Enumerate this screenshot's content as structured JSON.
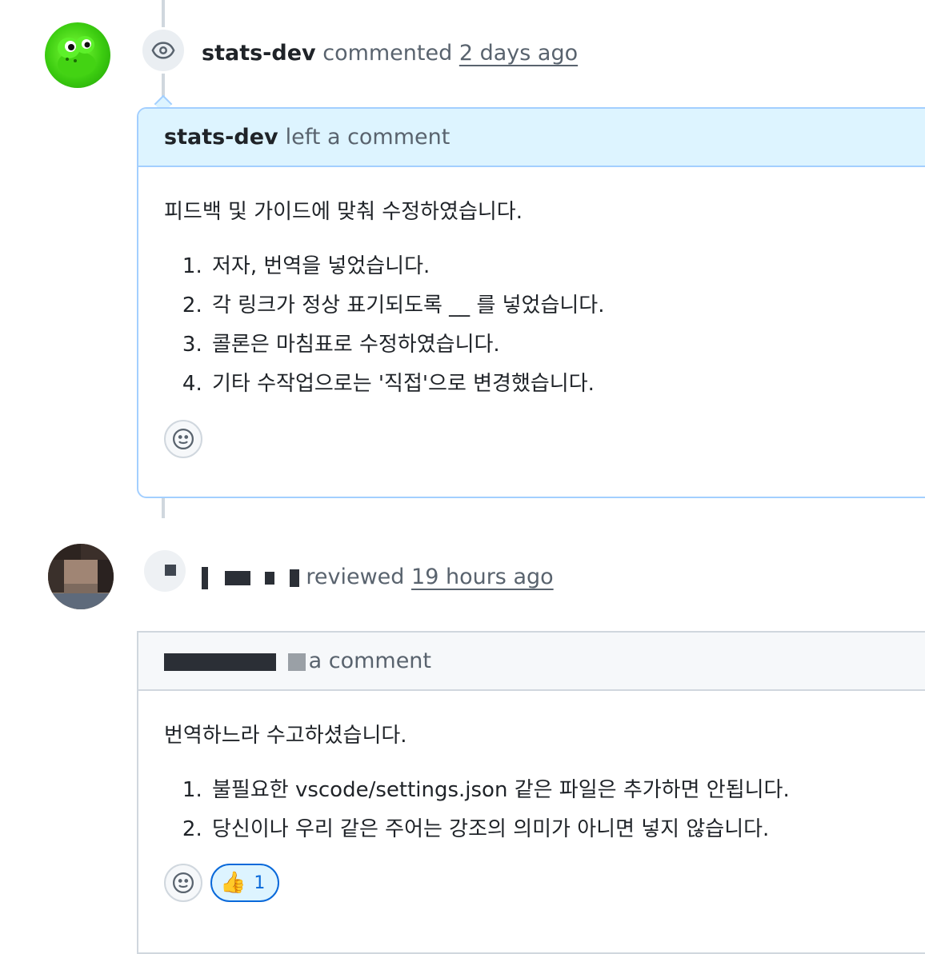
{
  "comments": [
    {
      "event_actor": "stats-dev",
      "event_verb": "commented",
      "event_time": "2 days ago",
      "event_icon": "eye-icon",
      "header_author": "stats-dev",
      "header_verb": "left a comment",
      "intro": "피드백 및 가이드에 맞춰 수정하였습니다.",
      "items": [
        "저자, 번역을 넣었습니다.",
        "각 링크가 정상 표기되도록 __ 를 넣었습니다.",
        "콜론은 마침표로 수정하였습니다.",
        "기타 수작업으로는 '직접'으로 변경했습니다."
      ]
    },
    {
      "event_verb": "reviewed",
      "event_time": "19 hours ago",
      "header_verb": "a comment",
      "intro": "번역하느라 수고하셨습니다.",
      "items": [
        "불필요한 vscode/settings.json 같은 파일은 추가하면 안됩니다.",
        "당신이나 우리 같은 주어는 강조의 의미가 아니면 넣지 않습니다."
      ],
      "reaction": {
        "emoji": "👍",
        "count": "1"
      }
    }
  ],
  "colors": {
    "accent": "#0969da",
    "header_bg": "#ddf4ff",
    "border_blue": "#a3cfff",
    "muted_text": "#59636e"
  }
}
